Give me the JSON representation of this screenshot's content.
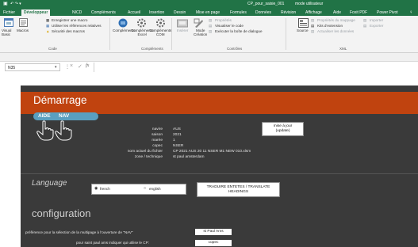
{
  "titlebar": {
    "quick": "↶ ↷ ▾",
    "filename": "CP_pour_saisie_001",
    "mode": "mode utilisateur"
  },
  "tabs": [
    "Fichier",
    "Développeur",
    "NICD",
    "Compléments",
    "Accueil",
    "Insertion",
    "Dessin",
    "Mise en page",
    "Formules",
    "Données",
    "Révision",
    "Affichage",
    "Aide",
    "Foxit PDF",
    "Power Pivot"
  ],
  "ribbon": {
    "code": {
      "visual_basic": "Visual\nBasic",
      "macros": "Macros",
      "record": "Enregistrer une macro",
      "relative": "Utiliser les références relatives",
      "security": "Sécurité des macros",
      "label": "Code"
    },
    "addins": {
      "complements": "Compléments",
      "excel": "Compléments\nExcel",
      "com": "Compléments\nCOM",
      "label": "Compléments"
    },
    "controls": {
      "inserer": "Insérer",
      "mode": "Mode\nCréation",
      "proprietes": "Propriétés",
      "code": "Visualiser le code",
      "dialog": "Exécuter la boîte de dialogue",
      "label": "Contrôles"
    },
    "xml": {
      "source": "Source",
      "mappage": "Propriétés du mappage",
      "ext": "Kits d'extension",
      "refresh": "Actualiser les données",
      "importer": "Importer",
      "exporter": "Exporter",
      "label": "XML"
    }
  },
  "formula": {
    "namebox": "N35",
    "fx": "fx"
  },
  "sheet": {
    "title": "Démarrage",
    "aide": "AIDE",
    "nav": "NAV",
    "fields": [
      {
        "label": "navire",
        "value": "AUS"
      },
      {
        "label": "saison",
        "value": "2021"
      },
      {
        "label": "marée",
        "value": "1"
      },
      {
        "label": "copec",
        "value": "NSER"
      },
      {
        "label": "nom actuel du fichier",
        "value": "CP 2021 AUS 20 11 NSER M1 NEW 010.xlsm"
      },
      {
        "label": "zone / technique",
        "value": "st paul amsterdam"
      }
    ],
    "maj_button": "mise à jour\n(update)",
    "language_title": "Language",
    "lang_french": "french",
    "lang_english": "english",
    "translate_button": "TRADUIRE ENTETES / TRANSLATE\nHEADINGS",
    "config_title": "configuration",
    "pref_label": "préférence pour la sélection de la multipage à l'ouverture de \"NAV\"",
    "pref_value": "st Paul Ams",
    "cp_label": "pour saint paul ams indiquer qui utilise le CP:",
    "cp_value": "copec"
  },
  "colors": {
    "excel_green": "#217346",
    "orange_banner": "#c0430f",
    "dark_panel": "#3a3a3a",
    "aide_pill": "#5a9fc0"
  }
}
